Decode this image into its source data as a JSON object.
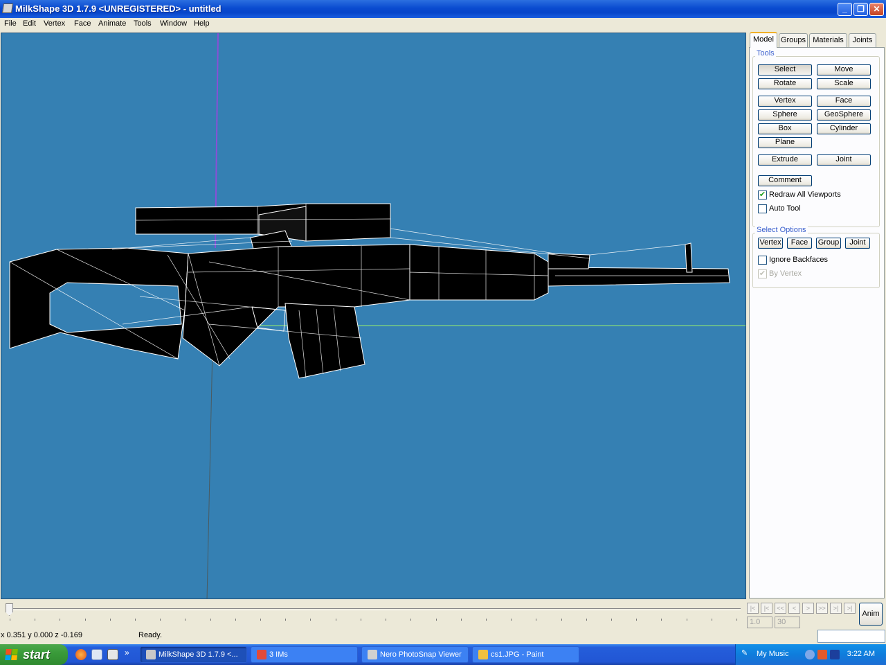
{
  "window": {
    "title": "MilkShape 3D 1.7.9 <UNREGISTERED> - untitled",
    "minimize": "_",
    "maximize": "❐",
    "close": "✕"
  },
  "menu": [
    "File",
    "Edit",
    "Vertex",
    "Face",
    "Animate",
    "Tools",
    "Window",
    "Help"
  ],
  "panel": {
    "tabs": [
      "Model",
      "Groups",
      "Materials",
      "Joints"
    ],
    "active_tab": "Model",
    "tools_label": "Tools",
    "tool_buttons": [
      "Select",
      "Move",
      "Rotate",
      "Scale",
      "Vertex",
      "Face",
      "Sphere",
      "GeoSphere",
      "Box",
      "Cylinder",
      "Plane",
      "Extrude",
      "Joint",
      "Comment"
    ],
    "redraw_all_viewports": {
      "label": "Redraw All Viewports",
      "checked": true,
      "mark": "✔"
    },
    "auto_tool": {
      "label": "Auto Tool",
      "checked": false
    },
    "select_options_label": "Select Options",
    "select_buttons": [
      "Vertex",
      "Face",
      "Group",
      "Joint"
    ],
    "ignore_backfaces": {
      "label": "Ignore Backfaces",
      "checked": false
    },
    "by_vertex": {
      "label": "By Vertex",
      "checked": true,
      "disabled": true,
      "mark": "✔"
    }
  },
  "timeline": {
    "nav_buttons": [
      "|<",
      "|<",
      "<<",
      "<",
      ">",
      ">>",
      ">|",
      ">|"
    ],
    "frame_current": "1.0",
    "frame_total": "30",
    "anim_label": "Anim"
  },
  "status": {
    "coords": "x 0.351 y 0.000 z -0.169",
    "message": "Ready."
  },
  "taskbar": {
    "start_label": "start",
    "tasks": [
      {
        "label": "MilkShape 3D 1.7.9 <...",
        "active": true,
        "icon_color": "#c8c8c8"
      },
      {
        "label": "3 IMs",
        "active": false,
        "icon_color": "#e24a3b"
      },
      {
        "label": "Nero PhotoSnap Viewer",
        "active": false,
        "icon_color": "#d0d0d0"
      },
      {
        "label": "cs1.JPG - Paint",
        "active": false,
        "icon_color": "#f0c040"
      }
    ],
    "tray_label": "My Music",
    "clock": "3:22 AM"
  },
  "colors": {
    "viewport_bg": "#3580b3",
    "axis_green": "#9cf06a",
    "axis_purple": "#8a4fd6"
  }
}
